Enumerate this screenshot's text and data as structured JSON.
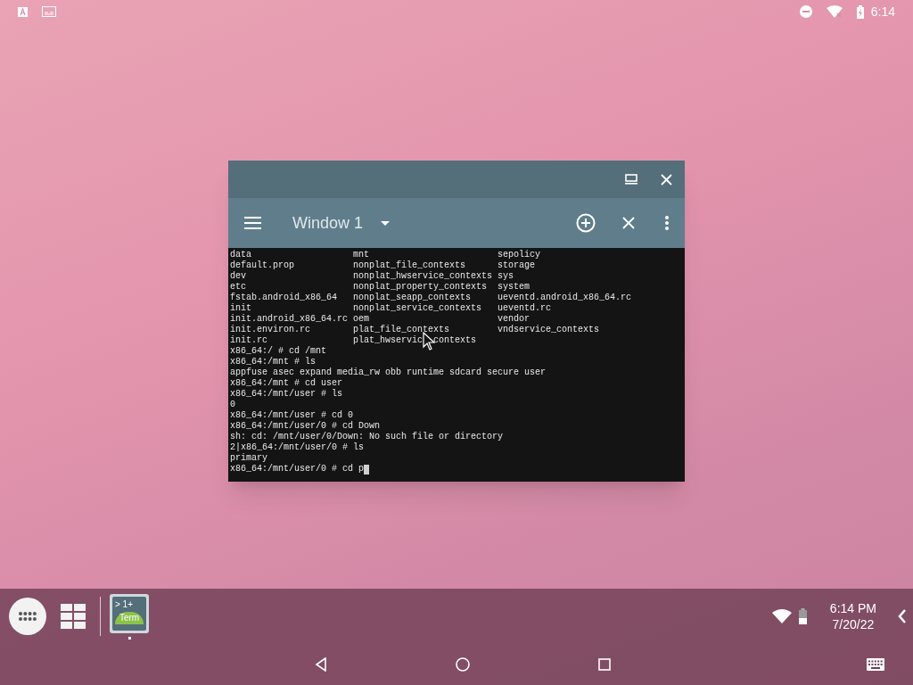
{
  "status_bar": {
    "time": "6:14"
  },
  "window": {
    "title": "Window 1",
    "terminal_lines": [
      "data                   mnt                        sepolicy",
      "default.prop           nonplat_file_contexts      storage",
      "dev                    nonplat_hwservice_contexts sys",
      "etc                    nonplat_property_contexts  system",
      "fstab.android_x86_64   nonplat_seapp_contexts     ueventd.android_x86_64.rc",
      "init                   nonplat_service_contexts   ueventd.rc",
      "init.android_x86_64.rc oem                        vendor",
      "init.environ.rc        plat_file_contexts         vndservice_contexts",
      [
        "init.rc                plat_hwservic",
        "contexts"
      ],
      "x86_64:/ # cd /mnt",
      "x86_64:/mnt # ls",
      "appfuse asec expand media_rw obb runtime sdcard secure user",
      "x86_64:/mnt # cd user",
      "x86_64:/mnt/user # ls",
      "0",
      "x86_64:/mnt/user # cd 0",
      "x86_64:/mnt/user/0 # cd Down",
      "sh: cd: /mnt/user/0/Down: No such file or directory",
      "2|x86_64:/mnt/user/0 # ls",
      "primary",
      "x86_64:/mnt/user/0 # cd p"
    ]
  },
  "taskbar": {
    "app_icon": {
      "line_1": "> 1+",
      "line_2": "Term"
    },
    "time": "6:14 PM",
    "date": "7/20/22"
  }
}
